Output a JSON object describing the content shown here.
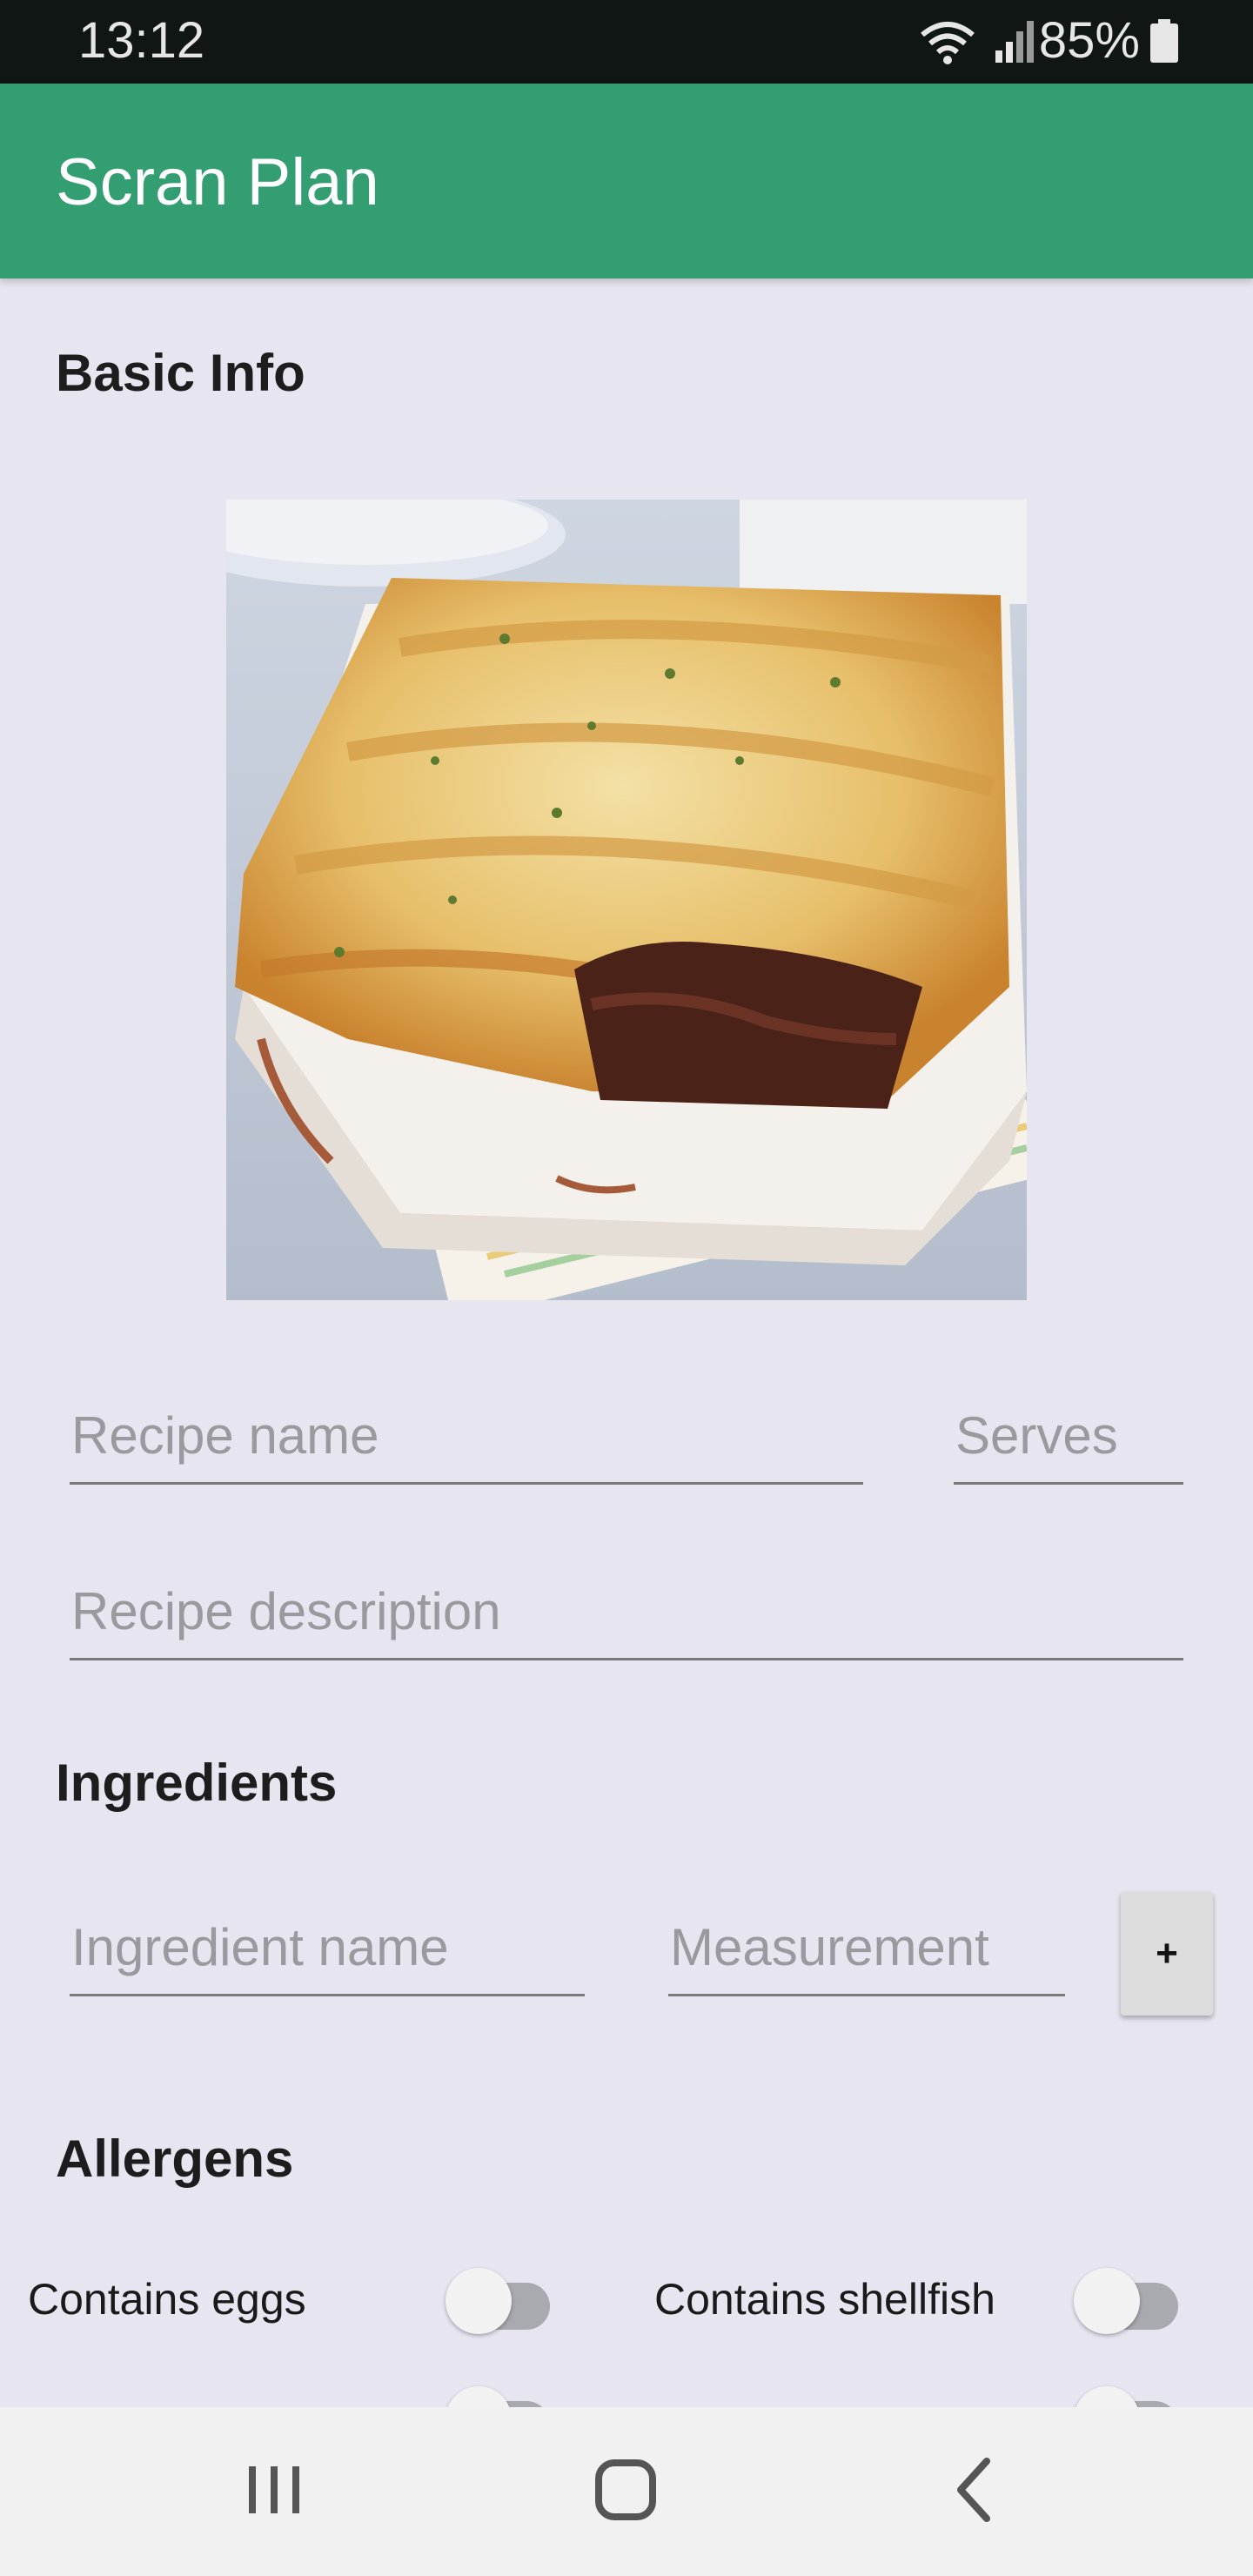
{
  "status_bar": {
    "time": "13:12",
    "battery_percent": "85%"
  },
  "app_bar": {
    "title": "Scran Plan"
  },
  "basic_info": {
    "heading": "Basic Info",
    "recipe_name_placeholder": "Recipe name",
    "serves_placeholder": "Serves",
    "description_placeholder": "Recipe description"
  },
  "ingredients": {
    "heading": "Ingredients",
    "name_placeholder": "Ingredient name",
    "measurement_placeholder": "Measurement",
    "add_label": "+"
  },
  "allergens": {
    "heading": "Allergens",
    "items": [
      {
        "label": "Contains eggs",
        "enabled": false
      },
      {
        "label": "Contains shellfish",
        "enabled": false
      }
    ]
  },
  "colors": {
    "app_bar": "#339e71",
    "background": "#e7e6f0"
  }
}
